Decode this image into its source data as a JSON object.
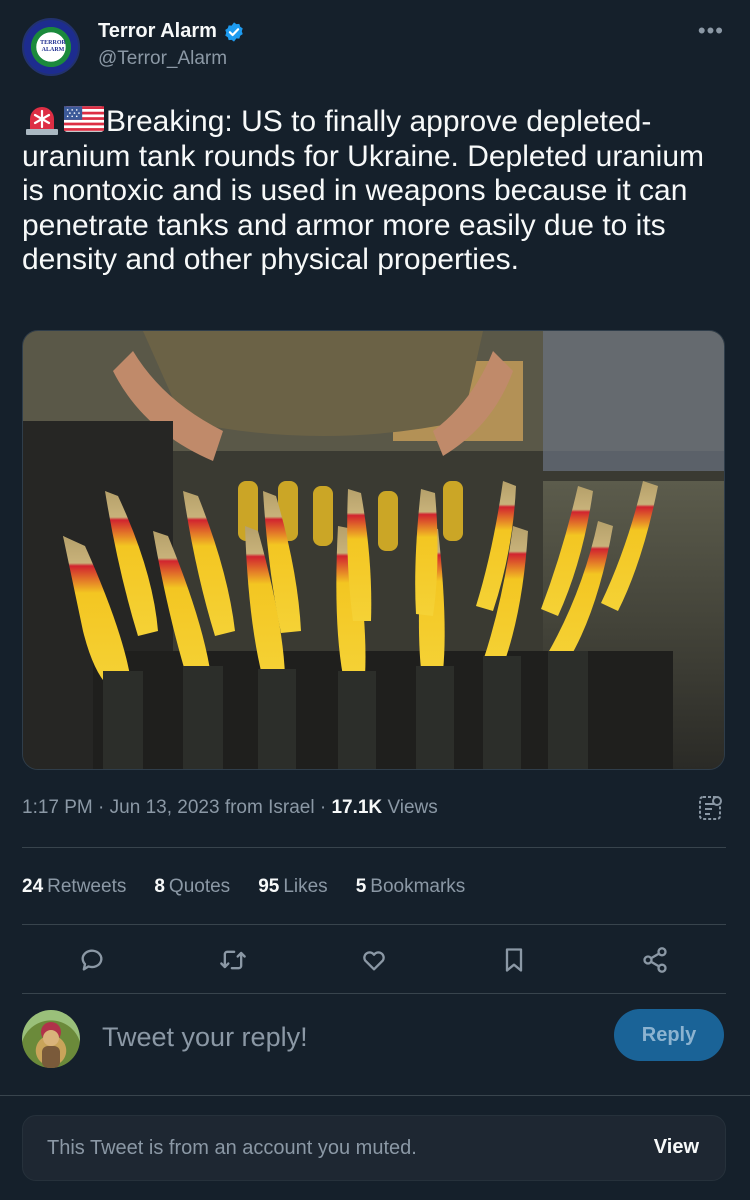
{
  "author": {
    "display_name": "Terror Alarm",
    "handle": "@Terror_Alarm",
    "avatar_text": "TERROR ALARM",
    "verified": true
  },
  "more_label": "•••",
  "tweet": {
    "text": "Breaking: US to finally approve depleted-uranium tank rounds for Ukraine. Depleted uranium is nontoxic and is used in weapons because it can penetrate tanks and armor more easily due to its density and other physical properties.",
    "emojis": [
      "police-light-emoji",
      "us-flag-emoji"
    ],
    "media_alt": "Photo of rows of yellow and red tipped tank ammunition rounds held by a person"
  },
  "meta": {
    "time": "1:17 PM",
    "separator": "·",
    "date": "Jun 13, 2023",
    "source": "from Israel",
    "views_count": "17.1K",
    "views_label": "Views"
  },
  "stats": {
    "retweets_count": "24",
    "retweets_label": "Retweets",
    "quotes_count": "8",
    "quotes_label": "Quotes",
    "likes_count": "95",
    "likes_label": "Likes",
    "bookmarks_count": "5",
    "bookmarks_label": "Bookmarks"
  },
  "actions": [
    "reply-icon",
    "retweet-icon",
    "like-icon",
    "bookmark-icon",
    "share-icon"
  ],
  "reply": {
    "placeholder": "Tweet your reply!",
    "button_label": "Reply"
  },
  "muted_notice": {
    "text": "This Tweet is from an account you muted.",
    "link_label": "View"
  },
  "colors": {
    "background": "#15202b",
    "text": "#f7f9f9",
    "secondary": "#8b98a5",
    "accent": "#1d9bf0",
    "reply_button": "#1a6397",
    "divider": "#38444d"
  }
}
